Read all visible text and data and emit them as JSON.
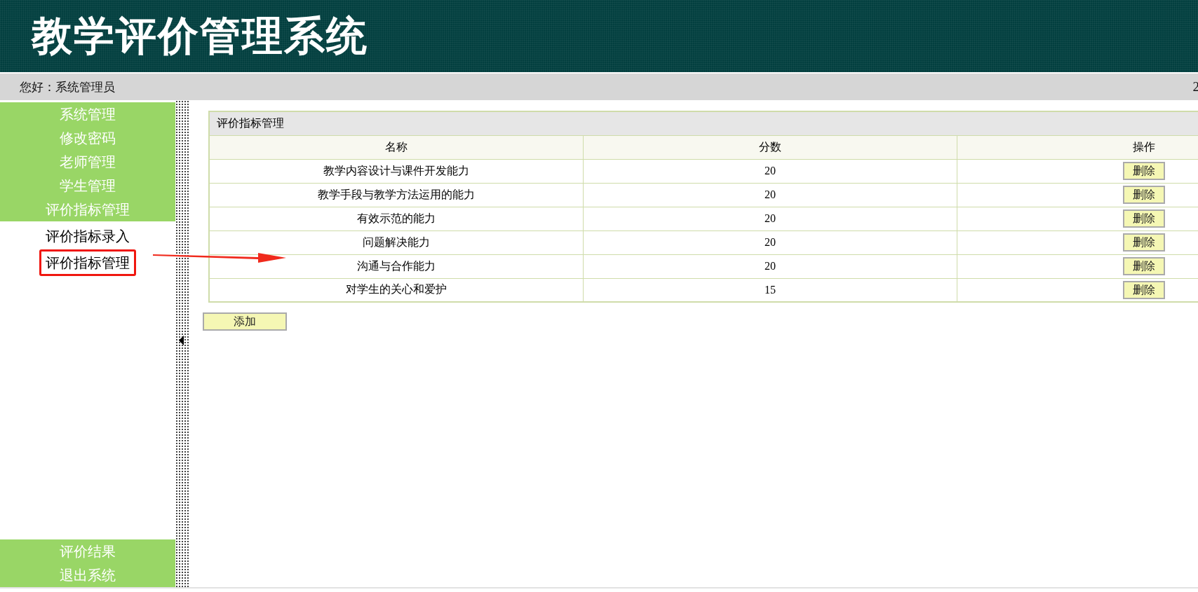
{
  "header": {
    "title": "教学评价管理系统"
  },
  "user_bar": {
    "greeting": "您好：系统管理员",
    "right_text": "2"
  },
  "sidebar": {
    "top_items": [
      {
        "label": "系统管理"
      },
      {
        "label": "修改密码"
      },
      {
        "label": "老师管理"
      },
      {
        "label": "学生管理"
      },
      {
        "label": "评价指标管理"
      }
    ],
    "sub_items": [
      {
        "label": "评价指标录入",
        "annotated": false
      },
      {
        "label": "评价指标管理",
        "annotated": true
      }
    ],
    "bottom_items": [
      {
        "label": "评价结果"
      },
      {
        "label": "退出系统"
      }
    ]
  },
  "panel": {
    "title": "评价指标管理",
    "columns": [
      "名称",
      "分数",
      "操作"
    ],
    "rows": [
      {
        "name": "教学内容设计与课件开发能力",
        "score": "20",
        "action": "删除"
      },
      {
        "name": "教学手段与教学方法运用的能力",
        "score": "20",
        "action": "删除"
      },
      {
        "name": "有效示范的能力",
        "score": "20",
        "action": "删除"
      },
      {
        "name": "问题解决能力",
        "score": "20",
        "action": "删除"
      },
      {
        "name": "沟通与合作能力",
        "score": "20",
        "action": "删除"
      },
      {
        "name": "对学生的关心和爱护",
        "score": "15",
        "action": "删除"
      }
    ],
    "add_button": "添加"
  }
}
